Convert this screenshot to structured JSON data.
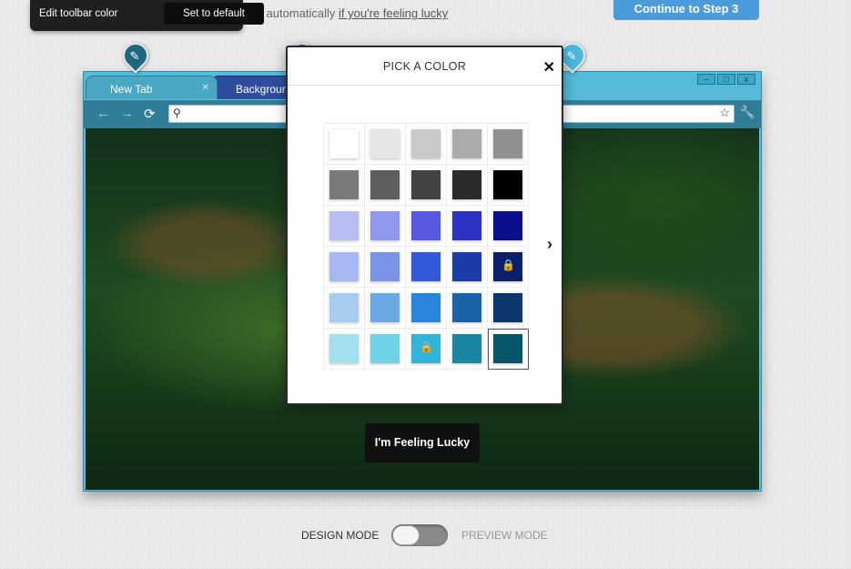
{
  "top_bar": {
    "hint_text": "lors automatically ",
    "lucky_link": "if you're feeling lucky",
    "continue_button": "Continue to Step 3"
  },
  "tooltip": {
    "label": "Edit toolbar color",
    "default_button": "Set to default"
  },
  "browser": {
    "tabs": [
      {
        "label": "New Tab"
      },
      {
        "label": "Background"
      }
    ],
    "window_controls": [
      "–",
      "□",
      "x"
    ]
  },
  "lucky_button": "I'm Feeling Lucky",
  "picker": {
    "title": "PICK A COLOR",
    "swatches": [
      {
        "color": "#ffffff"
      },
      {
        "color": "#e6e6e6"
      },
      {
        "color": "#c9c9c9"
      },
      {
        "color": "#ababab"
      },
      {
        "color": "#909090"
      },
      {
        "color": "#7a7a7a"
      },
      {
        "color": "#5e5e5e"
      },
      {
        "color": "#424242"
      },
      {
        "color": "#2b2b2b"
      },
      {
        "color": "#000000"
      },
      {
        "color": "#b8bdf2"
      },
      {
        "color": "#9198ee"
      },
      {
        "color": "#5858e0"
      },
      {
        "color": "#2d31c4"
      },
      {
        "color": "#0c0f8c"
      },
      {
        "color": "#a8b8f2"
      },
      {
        "color": "#7b94e8"
      },
      {
        "color": "#3159d8"
      },
      {
        "color": "#1c3caa"
      },
      {
        "color": "#0b1f6a",
        "locked": true
      },
      {
        "color": "#a9cdf0"
      },
      {
        "color": "#6aa9e4"
      },
      {
        "color": "#2a86db"
      },
      {
        "color": "#1963a8"
      },
      {
        "color": "#0c376c"
      },
      {
        "color": "#a3e0ef"
      },
      {
        "color": "#6fd3e8"
      },
      {
        "color": "#32b3d7",
        "locked": true
      },
      {
        "color": "#1987a3"
      },
      {
        "color": "#07566a",
        "selected": true
      }
    ]
  },
  "mode": {
    "design_label": "DESIGN MODE",
    "preview_label": "PREVIEW MODE",
    "active": "design"
  }
}
